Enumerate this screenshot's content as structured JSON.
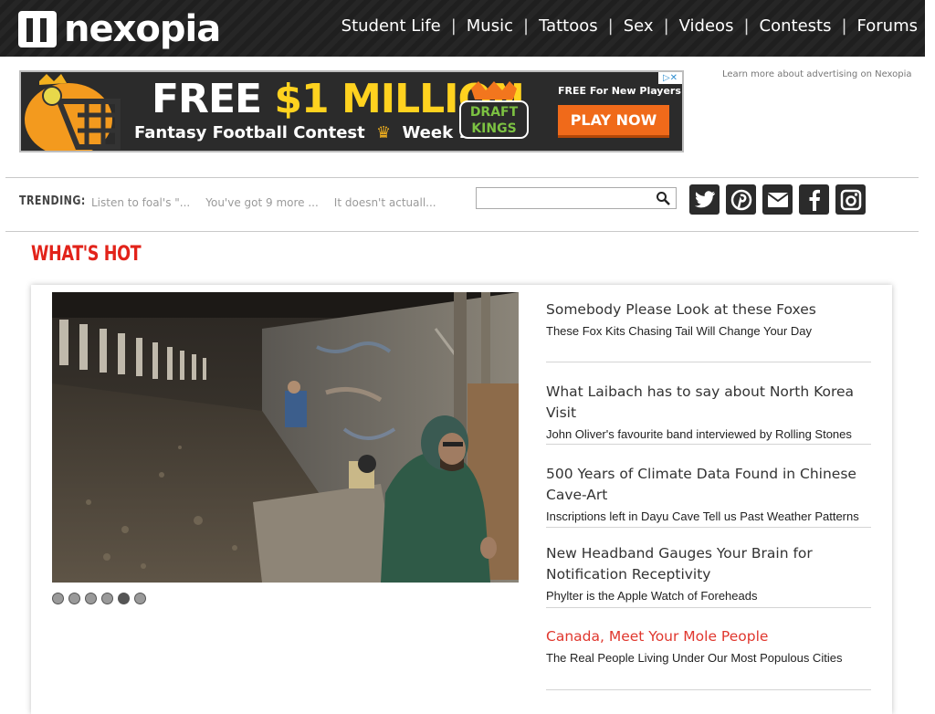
{
  "header": {
    "logo_text": "nexopia",
    "nav": [
      "Student Life",
      "Music",
      "Tattoos",
      "Sex",
      "Videos",
      "Contests",
      "Forums"
    ],
    "separator": "|"
  },
  "ad": {
    "headline_free": "FREE",
    "headline_amount": "$1 MILLION",
    "subline_left": "Fantasy Football Contest",
    "subline_right": "Week 1",
    "brand": "DRAFT KINGS",
    "new_players": "FREE For New Players",
    "cta": "PLAY NOW",
    "learn_more": "Learn more about advertising on Nexopia"
  },
  "trending": {
    "label": "TRENDING:",
    "items": [
      "Listen to foal's \"...",
      "You've got 9 more ...",
      "It doesn't actuall..."
    ]
  },
  "search": {
    "placeholder": ""
  },
  "socials": [
    "twitter-icon",
    "pinterest-icon",
    "mail-icon",
    "facebook-icon",
    "instagram-icon"
  ],
  "section_title": "WHAT'S HOT",
  "slider": {
    "dot_count": 6,
    "active_index": 4
  },
  "stories": [
    {
      "title": "Somebody Please Look at these Foxes",
      "desc": "These Fox Kits Chasing Tail Will Change Your Day",
      "highlight": false
    },
    {
      "title": "What Laibach has to say about North Korea Visit",
      "desc": "John Oliver's favourite band interviewed by Rolling Stones",
      "highlight": false
    },
    {
      "title": "500 Years of Climate Data Found in Chinese Cave-Art",
      "desc": "Inscriptions left in Dayu Cave Tell us Past Weather Patterns",
      "highlight": false
    },
    {
      "title": "New Headband Gauges Your Brain for Notification Receptivity",
      "desc": "Phylter is the Apple Watch of Foreheads",
      "highlight": false
    },
    {
      "title": "Canada, Meet Your Mole People",
      "desc": "The Real People Living Under Our Most Populous Cities",
      "highlight": true
    }
  ],
  "colors": {
    "accent_red": "#e2231a",
    "header_bg": "#232323",
    "cta_orange": "#f06a1a"
  }
}
